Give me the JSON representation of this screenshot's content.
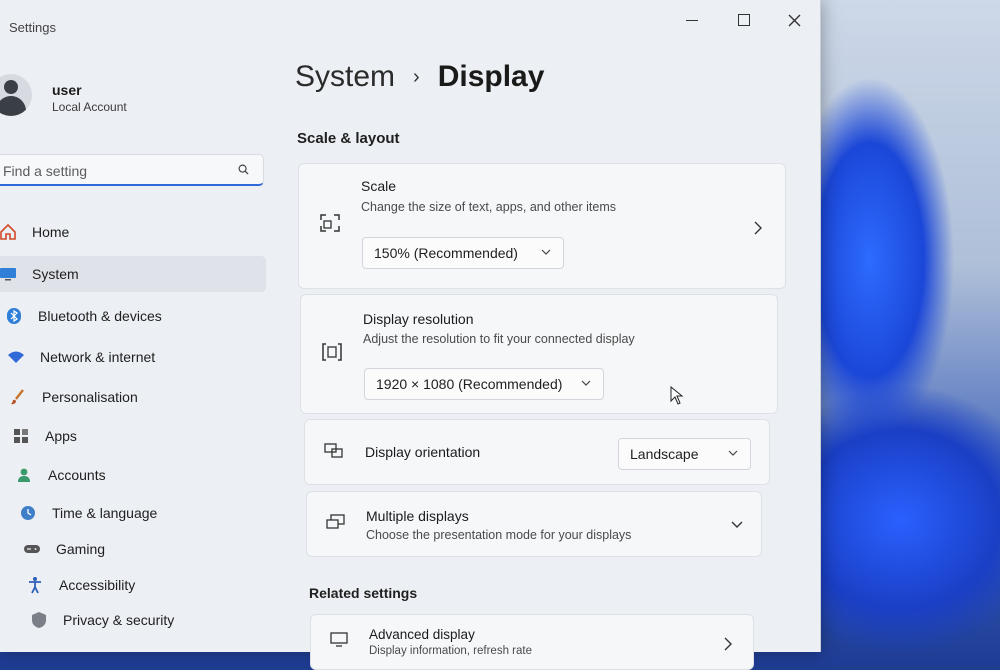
{
  "window": {
    "app_title": "Settings"
  },
  "user": {
    "name": "user",
    "account_type": "Local Account"
  },
  "search": {
    "placeholder": "Find a setting"
  },
  "sidebar": {
    "items": [
      {
        "label": "Home",
        "icon": "home-icon"
      },
      {
        "label": "System",
        "icon": "system-icon",
        "active": true
      },
      {
        "label": "Bluetooth & devices",
        "icon": "bluetooth-icon"
      },
      {
        "label": "Network & internet",
        "icon": "wifi-icon"
      },
      {
        "label": "Personalisation",
        "icon": "brush-icon"
      },
      {
        "label": "Apps",
        "icon": "apps-icon"
      },
      {
        "label": "Accounts",
        "icon": "person-icon"
      },
      {
        "label": "Time & language",
        "icon": "globe-clock-icon"
      },
      {
        "label": "Gaming",
        "icon": "gamepad-icon"
      },
      {
        "label": "Accessibility",
        "icon": "accessibility-icon"
      },
      {
        "label": "Privacy & security",
        "icon": "shield-icon"
      }
    ]
  },
  "breadcrumb": {
    "parent": "System",
    "separator": "›",
    "current": "Display"
  },
  "sections": {
    "scale_layout": "Scale & layout",
    "related": "Related settings"
  },
  "settings": {
    "scale": {
      "title": "Scale",
      "description": "Change the size of text, apps, and other items",
      "value": "150% (Recommended)"
    },
    "resolution": {
      "title": "Display resolution",
      "description": "Adjust the resolution to fit your connected display",
      "value": "1920 × 1080 (Recommended)"
    },
    "orientation": {
      "title": "Display orientation",
      "value": "Landscape"
    },
    "multiple_displays": {
      "title": "Multiple displays",
      "description": "Choose the presentation mode for your displays"
    },
    "advanced_display": {
      "title": "Advanced display",
      "description": "Display information, refresh rate"
    }
  },
  "colors": {
    "accent": "#2f6ad8",
    "window_bg": "#eceff3",
    "card_bg": "#f6f7f9"
  }
}
